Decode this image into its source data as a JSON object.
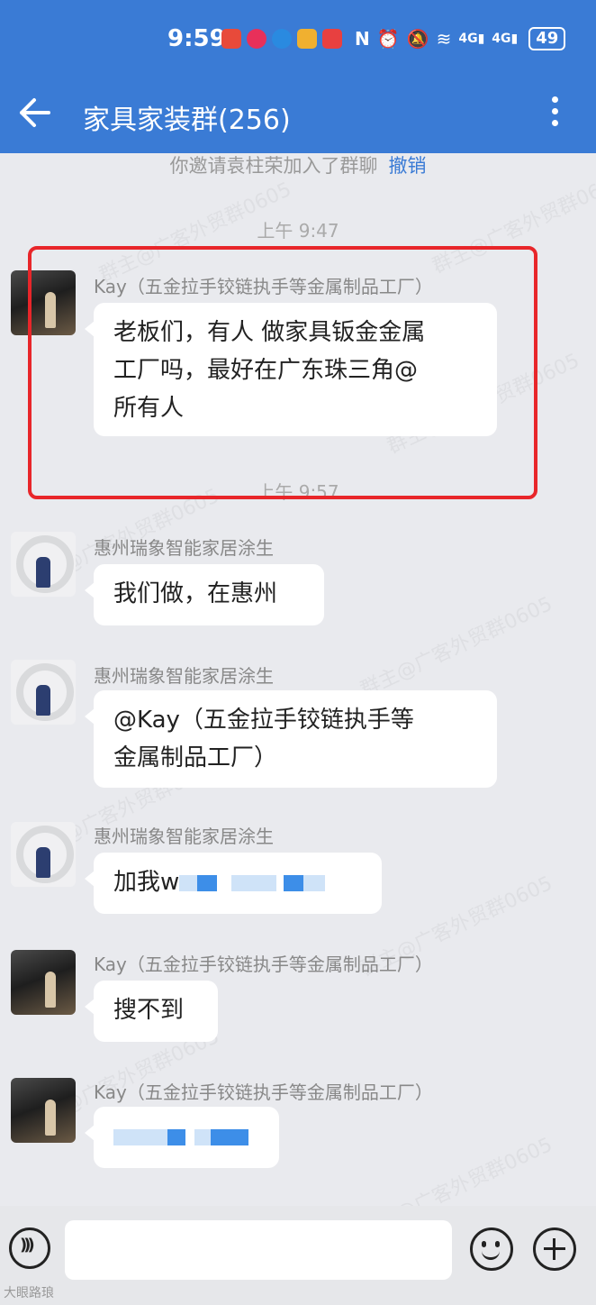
{
  "status_bar": {
    "time": "9:59",
    "battery": "49",
    "signal_labels": [
      "4G",
      "4G"
    ],
    "app_icon_colors": [
      "#e84a3a",
      "#e8305a",
      "#2a8ae0",
      "#f0b030",
      "#e84040"
    ]
  },
  "header": {
    "title": "家具家装群(256)",
    "accent": "#3a7bd5"
  },
  "system_message": {
    "text": "你邀请袁柱荣加入了群聊",
    "action": "撤销"
  },
  "timestamps": [
    "上午 9:47",
    "上午 9:57"
  ],
  "messages": [
    {
      "sender": "Kay（五金拉手铰链执手等金属制品工厂）",
      "lines": [
        "老板们，有人 做家具钣金金属",
        "工厂吗，最好在广东珠三角@",
        "所有人"
      ]
    },
    {
      "sender": "惠州瑞象智能家居涂生",
      "lines": [
        "我们做，在惠州"
      ]
    },
    {
      "sender": "惠州瑞象智能家居涂生",
      "lines": [
        "@Kay（五金拉手铰链执手等",
        "金属制品工厂）"
      ]
    },
    {
      "sender": "惠州瑞象智能家居涂生",
      "lines": [
        "加我w"
      ]
    },
    {
      "sender": "Kay（五金拉手铰链执手等金属制品工厂）",
      "lines": [
        "搜不到"
      ]
    },
    {
      "sender": "Kay（五金拉手铰链执手等金属制品工厂）",
      "lines": [
        ""
      ]
    }
  ],
  "watermark": {
    "text": "群主@广客外贸群0605"
  },
  "corner_watermark": "大眼路琅"
}
